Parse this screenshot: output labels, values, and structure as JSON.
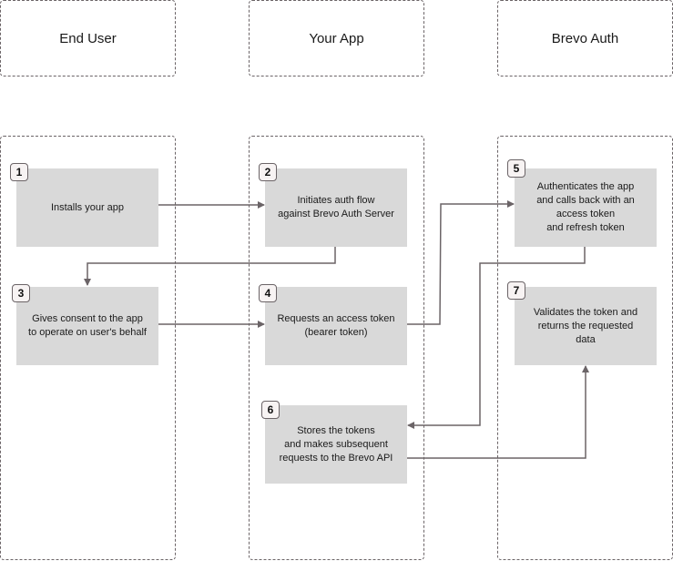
{
  "diagram": {
    "lanes": [
      {
        "id": "end-user",
        "title": "End User"
      },
      {
        "id": "your-app",
        "title": "Your App"
      },
      {
        "id": "brevo-auth",
        "title": "Brevo Auth"
      }
    ],
    "steps": [
      {
        "number": "1",
        "lane": "end-user",
        "text": "Installs your app"
      },
      {
        "number": "2",
        "lane": "your-app",
        "text": "Initiates auth flow\nagainst Brevo Auth Server"
      },
      {
        "number": "3",
        "lane": "end-user",
        "text": "Gives consent to the app\nto operate on user's behalf"
      },
      {
        "number": "4",
        "lane": "your-app",
        "text": "Requests an access token\n(bearer token)"
      },
      {
        "number": "5",
        "lane": "brevo-auth",
        "text": "Authenticates the app\nand calls back with an\naccess token\nand refresh token"
      },
      {
        "number": "6",
        "lane": "your-app",
        "text": "Stores the tokens\nand makes subsequent\nrequests to the Brevo API"
      },
      {
        "number": "7",
        "lane": "brevo-auth",
        "text": "Validates the token and\nreturns the requested\ndata"
      }
    ],
    "connections": [
      {
        "from": "1",
        "to": "2"
      },
      {
        "from": "2",
        "to": "3"
      },
      {
        "from": "3",
        "to": "4"
      },
      {
        "from": "4",
        "to": "5"
      },
      {
        "from": "5",
        "to": "6"
      },
      {
        "from": "6",
        "to": "7"
      }
    ],
    "colors": {
      "step_fill": "#d9d9d9",
      "lane_border": "#6b6467",
      "arrow": "#6b6467",
      "badge_fill": "#f7f3f3"
    }
  }
}
